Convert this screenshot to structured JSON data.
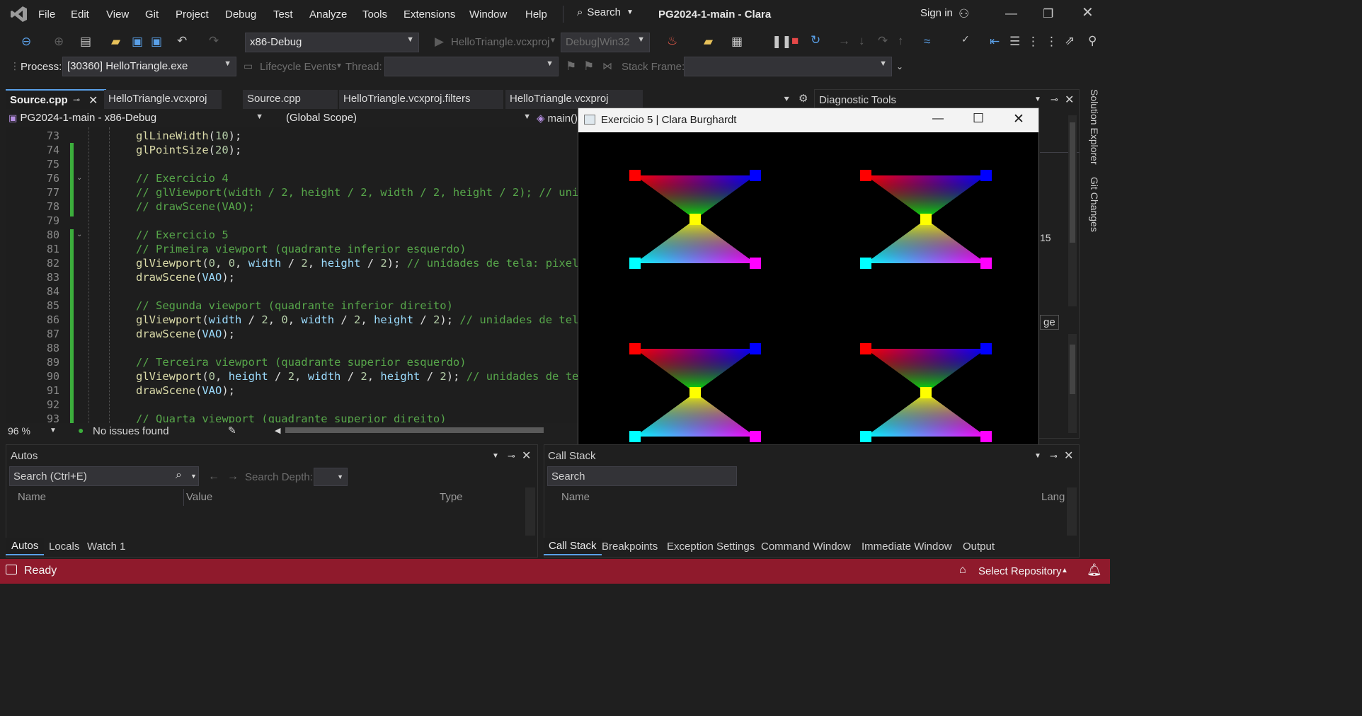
{
  "menu": [
    "File",
    "Edit",
    "View",
    "Git",
    "Project",
    "Debug",
    "Test",
    "Analyze",
    "Tools",
    "Extensions",
    "Window",
    "Help"
  ],
  "search_label": "Search",
  "window_title": "PG2024-1-main - Clara",
  "sign_in": "Sign in",
  "config": "x86-Debug",
  "run_target": "HelloTriangle.vcxproj",
  "platform": "Debug|Win32",
  "process_label": "Process:",
  "process_value": "[30360] HelloTriangle.exe",
  "lifecycle": "Lifecycle Events",
  "thread_label": "Thread:",
  "stackframe_label": "Stack Frame:",
  "tabs": [
    "Source.cpp",
    "HelloTriangle.vcxproj",
    "Source.cpp",
    "HelloTriangle.vcxproj.filters",
    "HelloTriangle.vcxproj"
  ],
  "diag_title": "Diagnostic Tools",
  "nav_project": "PG2024-1-main - x86-Debug",
  "nav_scope": "(Global Scope)",
  "nav_member": "main()",
  "side_tabs": [
    "Solution Explorer",
    "Git Changes"
  ],
  "line_numbers": [
    "73",
    "74",
    "75",
    "76",
    "77",
    "78",
    "79",
    "80",
    "81",
    "82",
    "83",
    "84",
    "85",
    "86",
    "87",
    "88",
    "89",
    "90",
    "91",
    "92",
    "93"
  ],
  "zoom": "96 %",
  "issues": "No issues found",
  "game_title": "Exercicio 5 | Clara Burghardt",
  "autos_title": "Autos",
  "autos_search": "Search (Ctrl+E)",
  "search_depth": "Search Depth:",
  "autos_cols": [
    "Name",
    "Value",
    "Type"
  ],
  "autos_tabs": [
    "Autos",
    "Locals",
    "Watch 1"
  ],
  "callstack_title": "Call Stack",
  "callstack_search": "Search",
  "callstack_cols": [
    "Name",
    "Lang"
  ],
  "bottom_tabs": [
    "Call Stack",
    "Breakpoints",
    "Exception Settings",
    "Command Window",
    "Immediate Window",
    "Output"
  ],
  "status_ready": "Ready",
  "select_repo": "Select Repository",
  "diag_fragments": [
    "15",
    "ge"
  ]
}
